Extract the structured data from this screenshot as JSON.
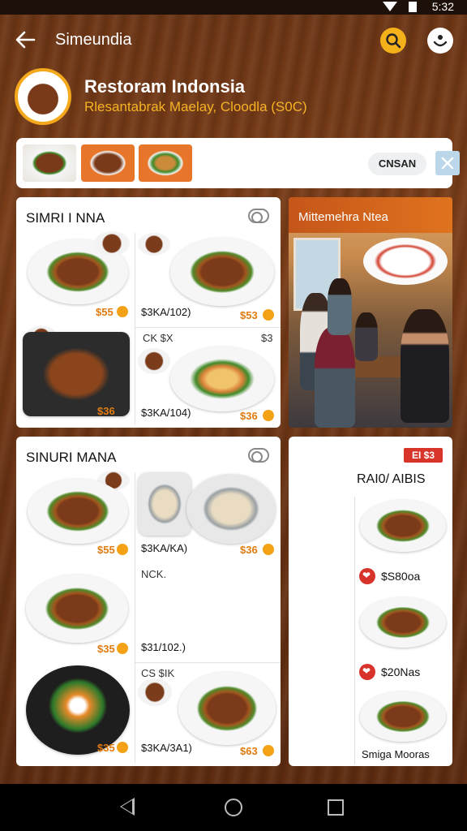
{
  "status_bar": {
    "time": "5:32"
  },
  "app_bar": {
    "title": "Simeundia",
    "back_icon": "arrow-left-icon",
    "search_icon": "search-icon",
    "user_icon": "user-icon",
    "accent": "#f5b119"
  },
  "restaurant": {
    "name": "Restoram Indonsia",
    "subtitle": "Rlesantabrak Maelay, Cloodla (S0C)"
  },
  "category_strip": {
    "pill_label": "CNSAN",
    "close_icon": "close-icon"
  },
  "menu_card_1": {
    "title": "SIMRI I NNA",
    "items": [
      {
        "price": "$55",
        "icon": "coin-icon"
      },
      {
        "price": "$3KA/102)"
      },
      {
        "price": "$53",
        "icon": "coin-icon"
      },
      {
        "label": "CK $X"
      },
      {
        "price": "$3"
      },
      {
        "price": "$3KA/104)"
      },
      {
        "price": "$36",
        "icon": "coin-icon"
      }
    ]
  },
  "photo_card": {
    "banner": "Mittemehra Ntea"
  },
  "menu_card_2": {
    "title": "SINURI MANA",
    "items": [
      {
        "price": "$55",
        "icon": "coin-icon"
      },
      {
        "price": "$3KA/KA)"
      },
      {
        "price": "$36",
        "icon": "coin-icon"
      },
      {
        "label": "NCK."
      },
      {
        "price": "$35",
        "icon": "coin-icon"
      },
      {
        "price": "$31/102.)"
      },
      {
        "label": "CS $IK"
      },
      {
        "price": "$35",
        "icon": "coin-icon"
      },
      {
        "price": "$3KA/3A1)"
      },
      {
        "price": "$63",
        "icon": "coin-icon"
      }
    ]
  },
  "side_card": {
    "badge": "EI $3",
    "title": "RAI0/ AIBIS",
    "entries": [
      {
        "price": "$S80oa",
        "icon": "heart-icon"
      },
      {
        "price": "$20Nas",
        "icon": "heart-icon"
      }
    ],
    "footer": "Smiga Mooras",
    "badge_color": "#d8352a"
  },
  "nav_bar": {
    "back_icon": "triangle-back-icon",
    "home_icon": "circle-home-icon",
    "recent_icon": "square-recent-icon"
  }
}
